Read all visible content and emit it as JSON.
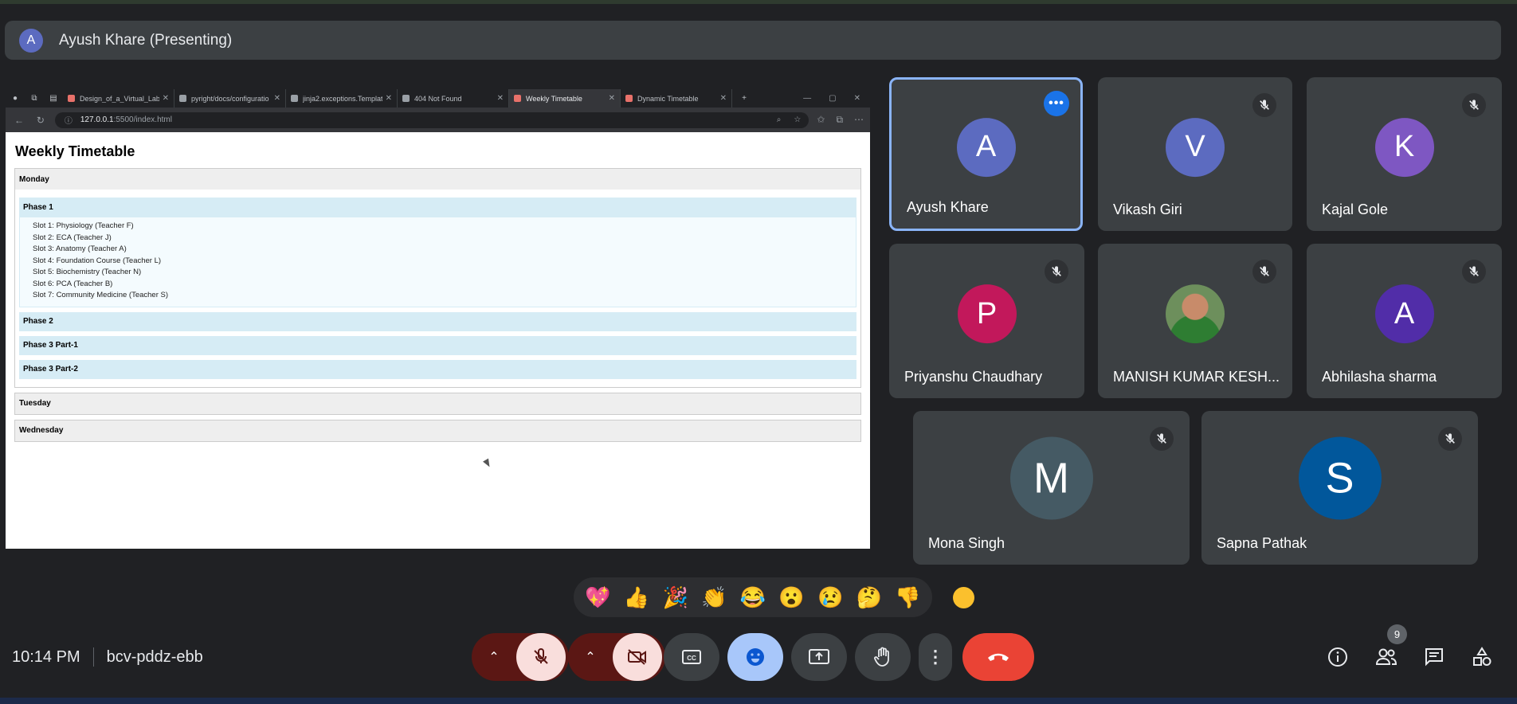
{
  "presenter": {
    "initial": "A",
    "label": "Ayush Khare (Presenting)"
  },
  "browser": {
    "tabs": [
      {
        "label": "Design_of_a_Virtual_Labo",
        "active": false
      },
      {
        "label": "pyright/docs/configuratio",
        "active": false
      },
      {
        "label": "jinja2.exceptions.Templat",
        "active": false
      },
      {
        "label": "404 Not Found",
        "active": false
      },
      {
        "label": "Weekly Timetable",
        "active": true
      },
      {
        "label": "Dynamic Timetable",
        "active": false
      }
    ],
    "url_host": "127.0.0.1",
    "url_rest": ":5500/index.html"
  },
  "timetable": {
    "title": "Weekly Timetable",
    "days": [
      {
        "name": "Monday",
        "phases": [
          {
            "name": "Phase 1",
            "slots": [
              "Slot 1: Physiology (Teacher F)",
              "Slot 2: ECA (Teacher J)",
              "Slot 3: Anatomy (Teacher A)",
              "Slot 4: Foundation Course (Teacher L)",
              "Slot 5: Biochemistry (Teacher N)",
              "Slot 6: PCA (Teacher B)",
              "Slot 7: Community Medicine (Teacher S)"
            ]
          },
          {
            "name": "Phase 2"
          },
          {
            "name": "Phase 3 Part-1"
          },
          {
            "name": "Phase 3 Part-2"
          }
        ]
      },
      {
        "name": "Tuesday"
      },
      {
        "name": "Wednesday"
      }
    ]
  },
  "participants": [
    {
      "name": "Ayush Khare",
      "initial": "A",
      "color": "#5c6bc0",
      "highlight": true
    },
    {
      "name": "Vikash Giri",
      "initial": "V",
      "color": "#5c6bc0"
    },
    {
      "name": "Kajal Gole",
      "initial": "K",
      "color": "#7e57c2"
    },
    {
      "name": "Priyanshu Chaudhary",
      "initial": "P",
      "color": "#c2185b"
    },
    {
      "name": "MANISH KUMAR KESH...",
      "initial": "",
      "color": "#6d8f5c",
      "photo": true
    },
    {
      "name": "Abhilasha sharma",
      "initial": "A",
      "color": "#512da8"
    },
    {
      "name": "Mona Singh",
      "initial": "M",
      "color": "#455a64"
    },
    {
      "name": "Sapna Pathak",
      "initial": "S",
      "color": "#01579b"
    }
  ],
  "reactions": [
    "💖",
    "👍",
    "🎉",
    "👏",
    "😂",
    "😮",
    "😢",
    "🤔",
    "👎"
  ],
  "meeting": {
    "time": "10:14 PM",
    "code": "bcv-pddz-ebb",
    "participant_count": "9"
  }
}
